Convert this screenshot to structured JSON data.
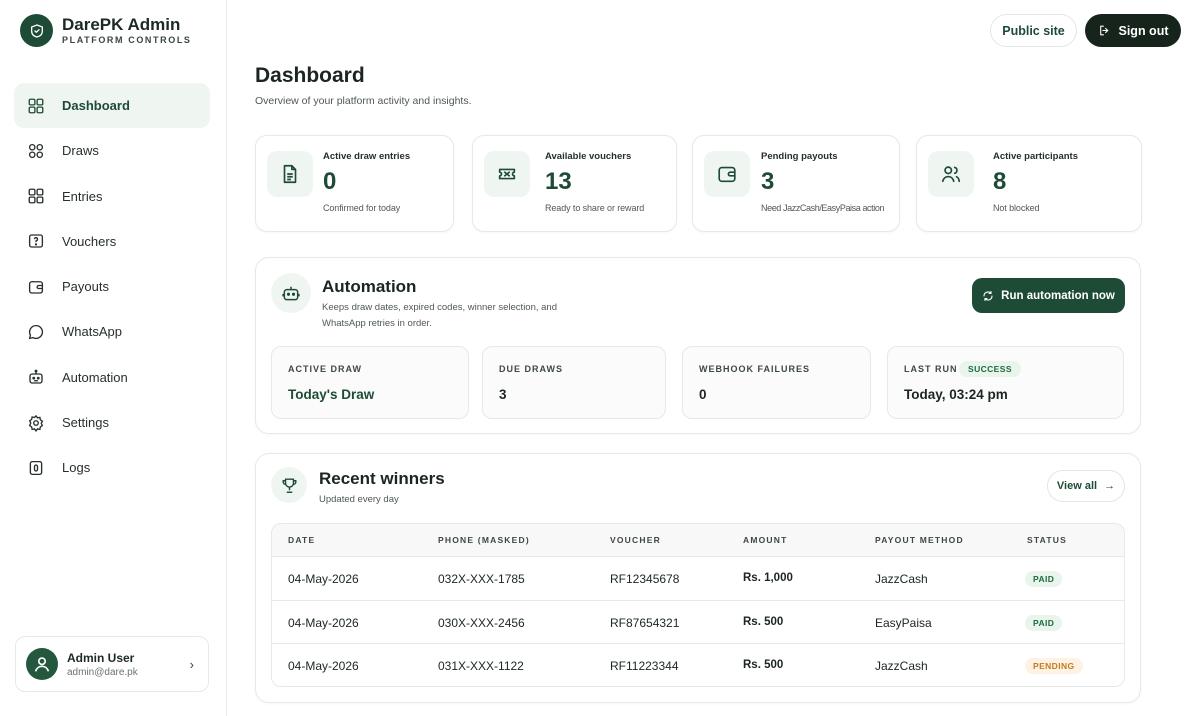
{
  "brand": {
    "title": "DarePK Admin",
    "subtitle": "PLATFORM CONTROLS",
    "logo_icon": "shield-icon"
  },
  "nav": {
    "items": [
      {
        "label": "Dashboard",
        "icon": "grid-icon",
        "active": true
      },
      {
        "label": "Draws",
        "icon": "circles-icon",
        "active": false
      },
      {
        "label": "Entries",
        "icon": "grid-icon",
        "active": false
      },
      {
        "label": "Vouchers",
        "icon": "ticket-icon",
        "active": false
      },
      {
        "label": "Payouts",
        "icon": "wallet-icon",
        "active": false
      },
      {
        "label": "WhatsApp",
        "icon": "chat-icon",
        "active": false
      },
      {
        "label": "Automation",
        "icon": "robot-icon",
        "active": false
      },
      {
        "label": "Settings",
        "icon": "gear-icon",
        "active": false
      },
      {
        "label": "Logs",
        "icon": "log-icon",
        "active": false
      }
    ]
  },
  "user": {
    "name": "Admin User",
    "email": "admin@dare.pk"
  },
  "header": {
    "public_site": "Public site",
    "sign_out": "Sign out"
  },
  "page": {
    "title": "Dashboard",
    "subtitle": "Overview of your platform activity and insights."
  },
  "stats": [
    {
      "label": "Active draw entries",
      "value": "0",
      "note": "Confirmed for today",
      "icon": "document-icon"
    },
    {
      "label": "Available vouchers",
      "value": "13",
      "note": "Ready to share or reward",
      "icon": "ticket-icon"
    },
    {
      "label": "Pending payouts",
      "value": "3",
      "note": "Need JazzCash/EasyPaisa action",
      "icon": "wallet-icon"
    },
    {
      "label": "Active participants",
      "value": "8",
      "note": "Not blocked",
      "icon": "users-icon"
    }
  ],
  "automation": {
    "title": "Automation",
    "description": "Keeps draw dates, expired codes, winner selection, and WhatsApp retries in order.",
    "run_button": "Run automation now",
    "metrics": [
      {
        "label": "ACTIVE DRAW",
        "value": "Today's Draw"
      },
      {
        "label": "DUE DRAWS",
        "value": "3"
      },
      {
        "label": "WEBHOOK FAILURES",
        "value": "0"
      },
      {
        "label": "LAST RUN",
        "value": "Today, 03:24 pm",
        "badge": "SUCCESS"
      }
    ]
  },
  "winners": {
    "title": "Recent winners",
    "subtitle": "Updated every day",
    "view_all": "View all",
    "columns": [
      "DATE",
      "PHONE (MASKED)",
      "VOUCHER",
      "AMOUNT",
      "PAYOUT METHOD",
      "STATUS"
    ],
    "rows": [
      {
        "date": "04-May-2026",
        "phone": "032X-XXX-1785",
        "voucher": "RF12345678",
        "amount": "Rs. 1,000",
        "method": "JazzCash",
        "status": "PAID"
      },
      {
        "date": "04-May-2026",
        "phone": "030X-XXX-2456",
        "voucher": "RF87654321",
        "amount": "Rs. 500",
        "method": "EasyPaisa",
        "status": "PAID"
      },
      {
        "date": "04-May-2026",
        "phone": "031X-XXX-1122",
        "voucher": "RF11223344",
        "amount": "Rs. 500",
        "method": "JazzCash",
        "status": "PENDING"
      }
    ]
  },
  "colors": {
    "primary": "#1e4b35",
    "dark": "#16241c",
    "accent_bg": "#eff6f1",
    "paid": "#1e6b3e",
    "pending": "#c77a1a"
  }
}
